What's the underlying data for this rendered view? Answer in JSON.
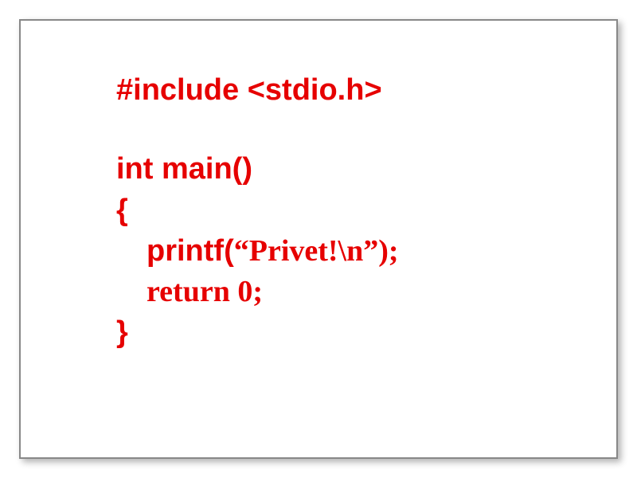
{
  "code": {
    "line1": "#include <stdio.h>",
    "line2": "int main()",
    "line3": "{",
    "line4_printf": "printf(",
    "line4_arg": "“Privet!\\n”);",
    "line5": "return 0;",
    "line6": "}"
  }
}
